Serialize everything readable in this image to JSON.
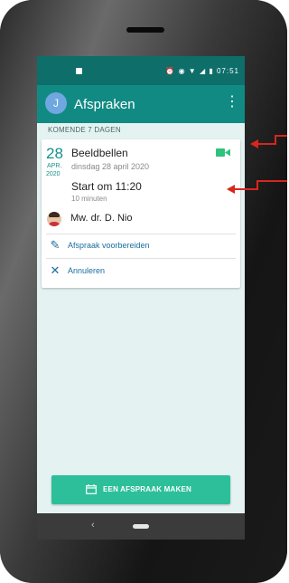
{
  "status_bar": {
    "time": "07:51",
    "icons": [
      "image-icon",
      "alarm-icon",
      "eye-icon",
      "wifi-icon",
      "signal-icon",
      "battery-icon"
    ]
  },
  "app_bar": {
    "avatar_letter": "J",
    "title": "Afspraken",
    "menu_icon": "more-vert-icon"
  },
  "section_header": "KOMENDE 7 DAGEN",
  "appointment": {
    "day": "28",
    "month": "APR.",
    "year": "2020",
    "title": "Beeldbellen",
    "date": "dinsdag 28 april 2020",
    "start": "Start om 11:20",
    "duration": "10 minuten",
    "doctor": "Mw. dr. D. Nio",
    "type_icon": "video-call-icon"
  },
  "actions": [
    {
      "label": "Afspraak voorbereiden",
      "icon": "edit-icon"
    },
    {
      "label": "Annuleren",
      "icon": "close-icon"
    }
  ],
  "cta": {
    "label": "EEN AFSPRAAK MAKEN",
    "icon": "calendar-icon"
  },
  "colors": {
    "statusbar": "#0d6e6a",
    "appbar": "#128a84",
    "accent": "#139088",
    "link": "#1b6fa0",
    "cta": "#2dbf9a",
    "video_icon": "#2ec27e",
    "annotation_arrow": "#d8261d"
  }
}
